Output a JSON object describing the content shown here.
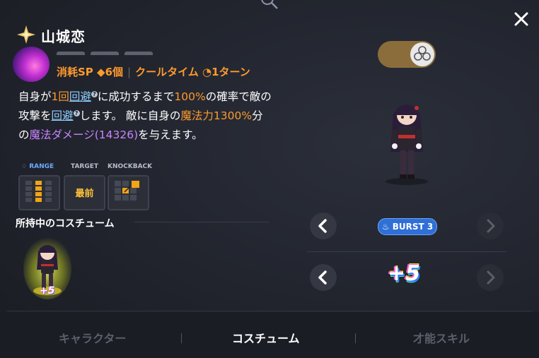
{
  "header": {
    "title": "山城恋",
    "close_icon": "close-icon",
    "star_icon": "sparkle-star-icon"
  },
  "skill": {
    "sp_label": "消耗SP",
    "sp_value": "◆6個",
    "cooldown_label": "クールタイム",
    "cooldown_value": "◔1ターン",
    "description": {
      "t1": "自身が",
      "t2": "1回",
      "t3": "回避",
      "t4": "に成功するまで",
      "t5": "100%",
      "t6": "の確率で敵の攻撃を",
      "t7": "回避",
      "t8": "します。 敵に自身の",
      "t9": "魔法力1300%",
      "t10": "分の",
      "t11": "魔法ダメージ(14326)",
      "t12": "を与えます。",
      "help_mark": "?"
    },
    "stats": {
      "range_label": "RANGE",
      "target_label": "TARGET",
      "target_value": "最前",
      "knockback_label": "KNOCKBACK"
    }
  },
  "costume": {
    "owned_label": "所持中のコスチューム",
    "thumb_badge": "+5"
  },
  "right_panel": {
    "toggle_icon": "clover-icon",
    "toggle_state": "on",
    "burst_label": "BURST 3",
    "burst_icon": "flame-icon",
    "enhance_label": "+5"
  },
  "tabs": [
    {
      "label": "キャラクター",
      "active": false
    },
    {
      "label": "コスチューム",
      "active": true
    },
    {
      "label": "才能スキル",
      "active": false
    }
  ],
  "colors": {
    "accent_orange": "#ff9a2e",
    "accent_purple": "#c884ff",
    "link_blue": "#8fd0ff",
    "toggle": "#8b6d3b",
    "burst": "#2f6fd6"
  }
}
